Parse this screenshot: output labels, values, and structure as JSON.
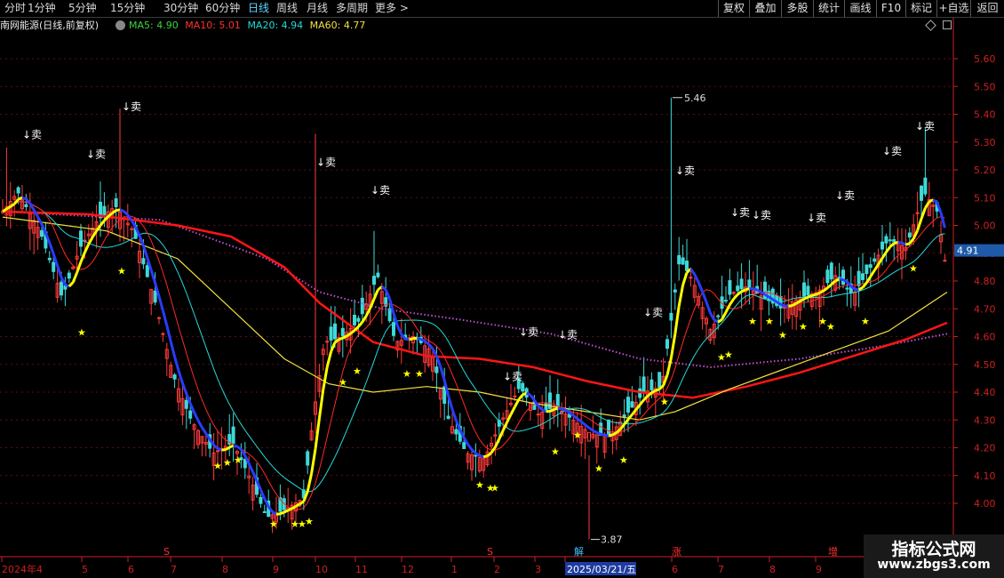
{
  "toolbar": {
    "left": [
      {
        "label": "分时",
        "active": false
      },
      {
        "label": "1分钟",
        "active": false
      },
      {
        "label": "5分钟",
        "active": false
      },
      {
        "label": "15分钟",
        "active": false
      },
      {
        "label": "30分钟",
        "active": false
      },
      {
        "label": "60分钟",
        "active": false
      },
      {
        "label": "日线",
        "active": true
      },
      {
        "label": "周线",
        "active": false
      },
      {
        "label": "月线",
        "active": false
      },
      {
        "label": "多周期",
        "active": false
      },
      {
        "label": "更多 >",
        "active": false
      }
    ],
    "right": [
      "复权",
      "叠加",
      "多股",
      "统计",
      "画线",
      "F10",
      "标记",
      "+自选",
      "返回"
    ]
  },
  "info": {
    "stock": "南网能源(日线,前复权)",
    "ma5": "MA5: 4.90",
    "ma10": "MA10: 5.01",
    "ma20": "MA20: 4.94",
    "ma60": "MA60: 4.77"
  },
  "colors": {
    "up": "#ff3b3b",
    "down": "#3fd8d8",
    "ma5": "#ffffff",
    "ma10": "#ff2020",
    "ma20": "#25d9d9",
    "ma60": "#f0e040",
    "long_ma": "#ff1f1f",
    "dot_ma": "#c050d0",
    "trend_up": "#ffff00",
    "trend_down": "#2a3cff",
    "axis": "#cc2020",
    "star": "#ffff00",
    "current_price_bg": "#1e5aa8"
  },
  "y_axis": {
    "ticks": [
      "5.60",
      "5.50",
      "5.40",
      "5.30",
      "5.20",
      "5.10",
      "5.00",
      "4.90",
      "4.80",
      "4.70",
      "4.60",
      "4.50",
      "4.40",
      "4.30",
      "4.20",
      "4.10",
      "4.00"
    ],
    "current_price": "4.91"
  },
  "x_axis": {
    "labels": [
      "2024年4",
      "5",
      "6",
      "7",
      "8",
      "9",
      "10",
      "11",
      "12",
      "1",
      "2",
      "3",
      "2025/03/21/五",
      "6",
      "7",
      "8",
      "9"
    ],
    "highlighted": "2025/03/21/五"
  },
  "annotations": {
    "high_label": "5.46",
    "low_label": "3.87",
    "sell": "↓卖",
    "event_marks": [
      {
        "text": "S",
        "color": "#ff3030"
      },
      {
        "text": "S",
        "color": "#ff3030"
      },
      {
        "text": "解",
        "color": "#40c0ff"
      },
      {
        "text": "涨",
        "color": "#ff3030"
      },
      {
        "text": "增",
        "color": "#ff3030"
      }
    ]
  },
  "watermark": {
    "title": "指标公式网",
    "url": "www.zbgs3.com"
  }
}
